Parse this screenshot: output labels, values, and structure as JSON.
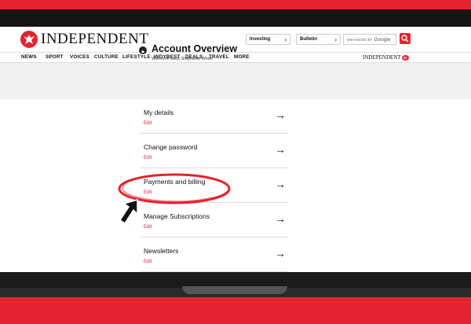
{
  "site": {
    "name": "INDEPENDENT",
    "investing_label": "Investing",
    "bulletin_label": "Bulletin",
    "search_enhanced": "ENHANCED BY",
    "search_brand": "Google",
    "nav": [
      "NEWS",
      "SPORT",
      "VOICES",
      "CULTURE",
      "LIFESTYLE",
      "INDYBEST",
      "DEALS",
      "TRAVEL",
      "MORE"
    ],
    "nav_logo": "INDEPENDENT",
    "nav_logo_badge": "tv"
  },
  "account": {
    "title": "Account Overview",
    "welcome": "Welcome back Stephanie White"
  },
  "items": [
    {
      "title": "My details",
      "action": "Edit"
    },
    {
      "title": "Change password",
      "action": "Edit"
    },
    {
      "title": "Payments and billing",
      "action": "Edit"
    },
    {
      "title": "Manage Subscriptions",
      "action": "Edit"
    },
    {
      "title": "Newsletters",
      "action": "Edit"
    }
  ],
  "colors": {
    "brand": "#e52330",
    "laptop_body": "#151515"
  },
  "icons": {
    "arrow": "→",
    "search": "search-icon",
    "account": "user-circle-icon"
  }
}
